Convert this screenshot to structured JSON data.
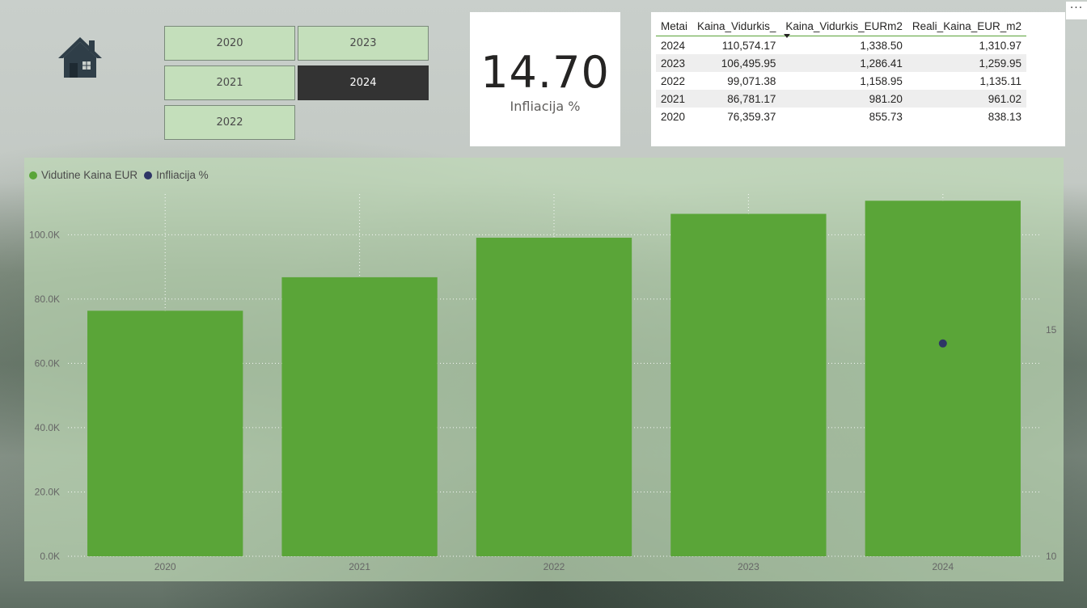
{
  "slicer": {
    "years": [
      {
        "label": "2020",
        "selected": false
      },
      {
        "label": "2023",
        "selected": false
      },
      {
        "label": "2021",
        "selected": false
      },
      {
        "label": "2024",
        "selected": true
      },
      {
        "label": "2022",
        "selected": false
      }
    ]
  },
  "kpi_card": {
    "value": "14.70",
    "label": "Infliacija %"
  },
  "table": {
    "headers": [
      "Metai",
      "Kaina_Vidurkis_",
      "Kaina_Vidurkis_EURm2",
      "Reali_Kaina_EUR_m2"
    ],
    "rows": [
      [
        "2024",
        "110,574.17",
        "1,338.50",
        "1,310.97"
      ],
      [
        "2023",
        "106,495.95",
        "1,286.41",
        "1,259.95"
      ],
      [
        "2022",
        "99,071.38",
        "1,158.95",
        "1,135.11"
      ],
      [
        "2021",
        "86,781.17",
        "981.20",
        "961.02"
      ],
      [
        "2020",
        "76,359.37",
        "855.73",
        "838.13"
      ]
    ],
    "sorted_column": "Kaina_Vidurkis_EURm2"
  },
  "more_options": "···",
  "colors": {
    "bar": "#5aa538",
    "inflation_dot": "#2e3566",
    "slicer_bg": "#c4dfbb",
    "slicer_selected": "#333333"
  },
  "chart_data": {
    "type": "bar",
    "categories": [
      "2020",
      "2021",
      "2022",
      "2023",
      "2024"
    ],
    "series": [
      {
        "name": "Vidutine Kaina EUR",
        "type": "bar",
        "axis": "left",
        "values": [
          76359.37,
          86781.17,
          99071.38,
          106495.95,
          110574.17
        ]
      },
      {
        "name": "Infliacija %",
        "type": "scatter",
        "axis": "right",
        "values": [
          null,
          null,
          null,
          null,
          14.7
        ]
      }
    ],
    "y_left": {
      "min": 0,
      "max": 100000,
      "ticks": [
        0,
        20000,
        40000,
        60000,
        80000,
        100000
      ],
      "tick_labels": [
        "0.0K",
        "20.0K",
        "40.0K",
        "60.0K",
        "80.0K",
        "100.0K"
      ]
    },
    "y_right": {
      "ticks": [
        10,
        15
      ],
      "tick_labels": [
        "10",
        "15"
      ]
    },
    "grid": true,
    "legend": "top-left"
  }
}
